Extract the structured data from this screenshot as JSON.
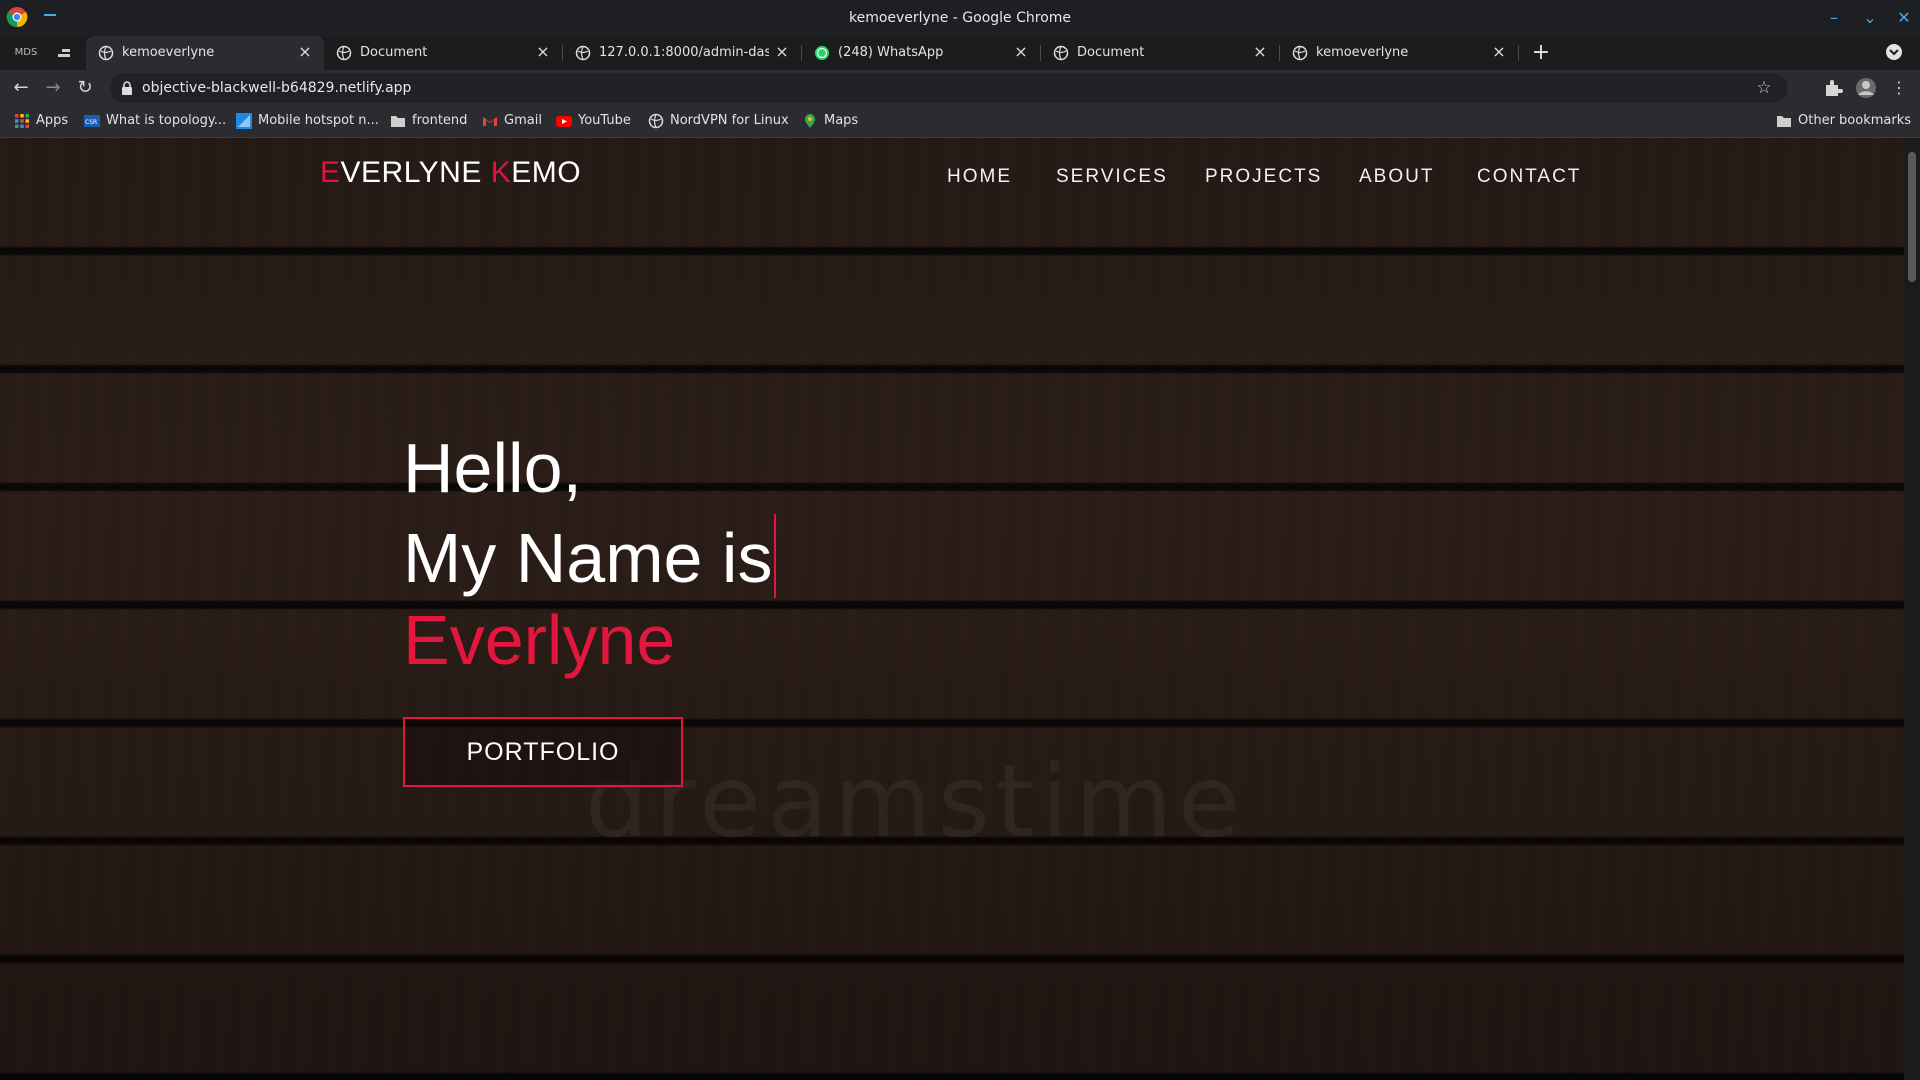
{
  "window": {
    "title": "kemoeverlyne - Google Chrome"
  },
  "tabs": [
    {
      "title": "kemoeverlyne",
      "active": true
    },
    {
      "title": "Document",
      "active": false
    },
    {
      "title": "127.0.0.1:8000/admin-dashbo",
      "active": false
    },
    {
      "title": "(248) WhatsApp",
      "active": false
    },
    {
      "title": "Document",
      "active": false
    },
    {
      "title": "kemoeverlyne",
      "active": false
    }
  ],
  "pinned_tabs": [
    "MDS",
    ""
  ],
  "address_bar": {
    "url": "objective-blackwell-b64829.netlify.app"
  },
  "bookmarks": {
    "items": [
      {
        "label": "Apps",
        "icon": "apps-grid-icon"
      },
      {
        "label": "What is topology...",
        "icon": "csr-icon"
      },
      {
        "label": "Mobile hotspot n...",
        "icon": "hotspot-icon"
      },
      {
        "label": "frontend",
        "icon": "folder-icon"
      },
      {
        "label": "Gmail",
        "icon": "gmail-icon"
      },
      {
        "label": "YouTube",
        "icon": "youtube-icon"
      },
      {
        "label": "NordVPN for Linux",
        "icon": "globe-icon"
      },
      {
        "label": "Maps",
        "icon": "maps-pin-icon"
      }
    ],
    "other": "Other bookmarks"
  },
  "site": {
    "logo": {
      "first_initial": "E",
      "first_rest": "VERLYNE ",
      "last_initial": "K",
      "last_rest": "EMO"
    },
    "nav": [
      "HOME",
      "SERVICES",
      "PROJECTS",
      "ABOUT",
      "CONTACT"
    ],
    "hero": {
      "line1": "Hello,",
      "line2": "My Name is",
      "name": "Everlyne",
      "button": "PORTFOLIO"
    },
    "watermark": "dreamstime",
    "accent_color": "#e3173e"
  }
}
